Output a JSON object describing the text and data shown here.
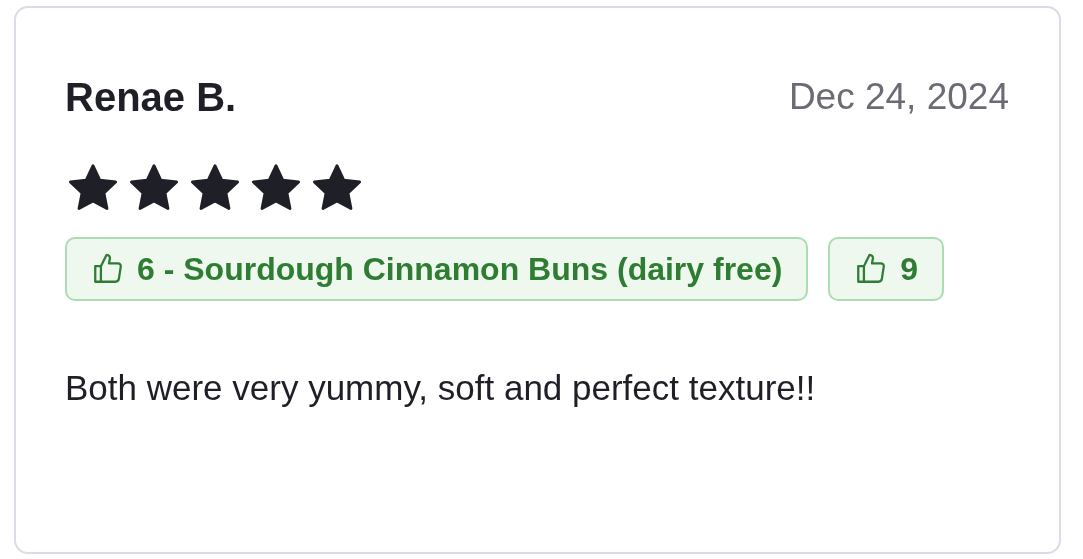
{
  "review": {
    "author": "Renae B.",
    "date": "Dec 24, 2024",
    "stars": 5,
    "tags": [
      {
        "label": "6 - Sourdough Cinnamon Buns (dairy free)"
      },
      {
        "label": "9"
      }
    ],
    "text": "Both were very yummy, soft and perfect texture!!"
  }
}
